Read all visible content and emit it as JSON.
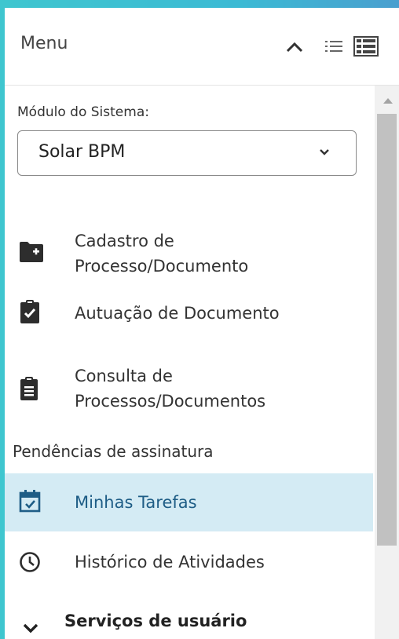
{
  "header": {
    "title": "Menu"
  },
  "module": {
    "label": "Módulo do Sistema:",
    "selected": "Solar BPM"
  },
  "items": [
    {
      "label1": "Cadastro de",
      "label2": "Processo/Documento",
      "icon": "folder-plus-icon"
    },
    {
      "label1": "Autuação de Documento",
      "icon": "clipboard-check-icon"
    },
    {
      "label1": "Consulta de",
      "label2": "Processos/Documentos",
      "icon": "clipboard-list-icon"
    }
  ],
  "section": "Pendências de assinatura",
  "tasks": {
    "label": "Minhas Tarefas",
    "icon": "calendar-check-icon",
    "active": true
  },
  "history": {
    "label": "Histórico de Atividades",
    "icon": "clock-icon"
  },
  "services": {
    "label": "Serviços de usuário",
    "icon": "chevron-down-icon"
  },
  "colors": {
    "accent": "#3fc6cf",
    "active_bg": "#d4ebf4",
    "active_text": "#1e5d86"
  }
}
